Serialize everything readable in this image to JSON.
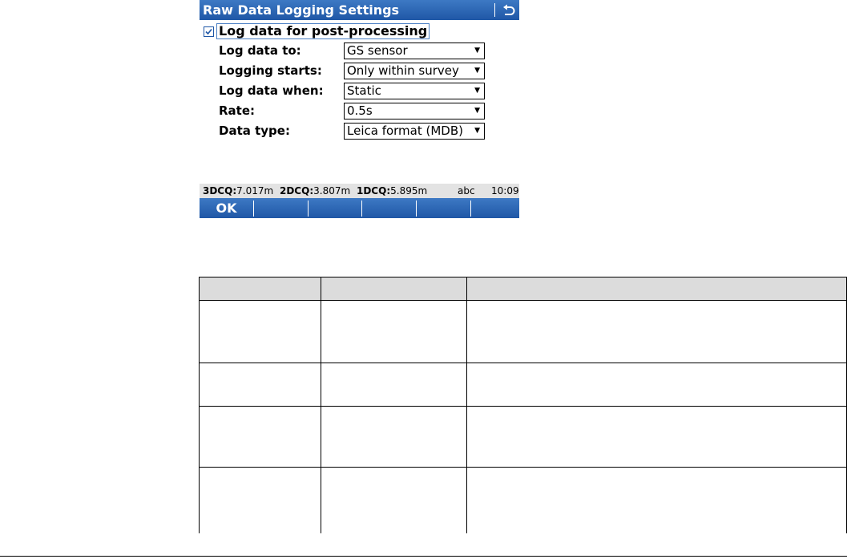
{
  "screen": {
    "title": "Raw Data Logging Settings",
    "back_icon": "back-arrow-icon",
    "checkbox": {
      "label": "Log data for post-processing",
      "checked": true
    },
    "fields": [
      {
        "label": "Log data to:",
        "value": "GS sensor"
      },
      {
        "label": "Logging starts:",
        "value": "Only within survey"
      },
      {
        "label": "Log data when:",
        "value": "Static"
      },
      {
        "label": "Rate:",
        "value": "0.5s"
      },
      {
        "label": "Data type:",
        "value": "Leica format (MDB)"
      }
    ],
    "status": {
      "q3d_label": "3DCQ:",
      "q3d_value": "7.017m",
      "q2d_label": "2DCQ:",
      "q2d_value": "3.807m",
      "q1d_label": "1DCQ:",
      "q1d_value": "5.895m",
      "input_mode": "abc",
      "time": "10:09"
    },
    "softkeys": [
      "OK",
      "",
      "",
      "",
      "",
      ""
    ]
  },
  "colors": {
    "bar_blue": "#1f57a6",
    "status_gray": "#e3e3e3",
    "table_header": "#dcdcdc"
  }
}
